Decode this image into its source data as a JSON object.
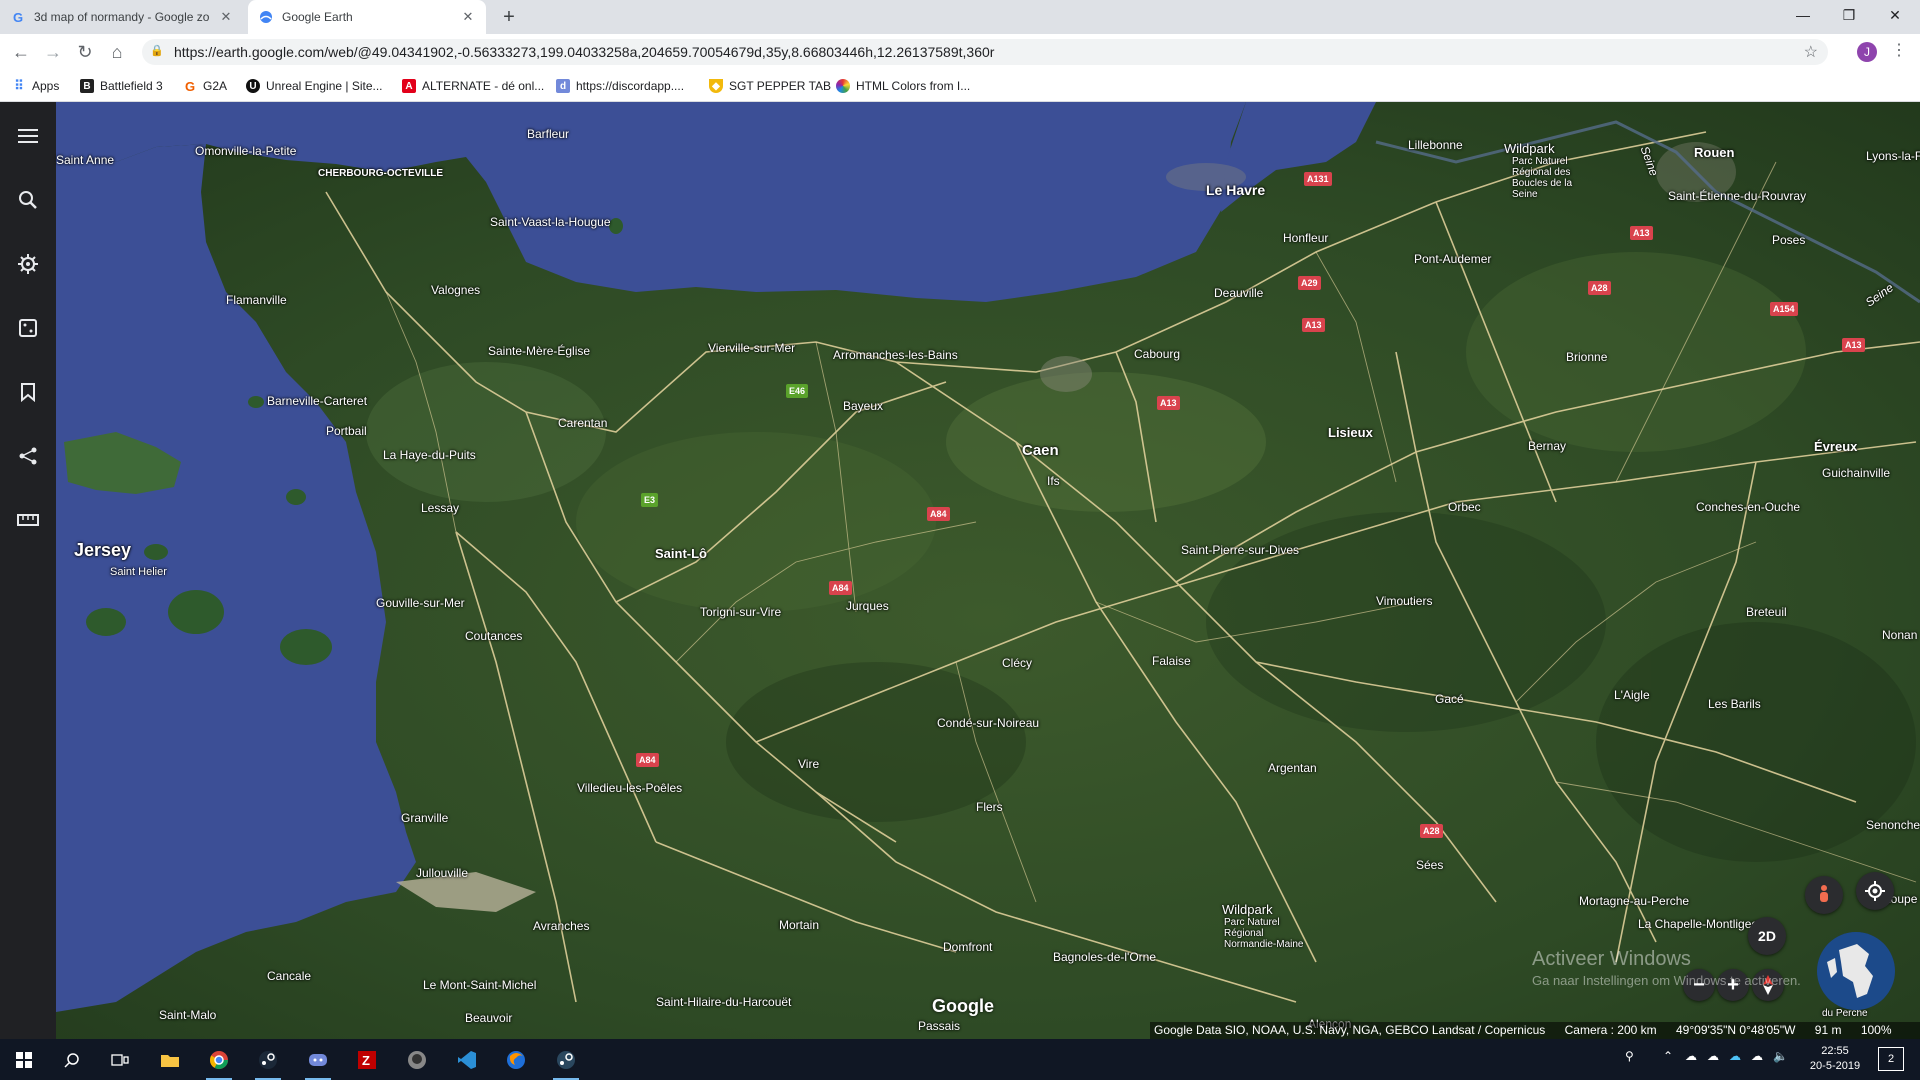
{
  "browser": {
    "tabs": [
      {
        "title": "3d map of normandy - Google zo",
        "active": false,
        "favicon": "google-icon"
      },
      {
        "title": "Google Earth",
        "active": true,
        "favicon": "earth-icon"
      }
    ],
    "url": "https://earth.google.com/web/@49.04341902,-0.56333273,199.04033258a,204659.70054679d,35y,8.66803446h,12.26137589t,360r",
    "profile_initial": "J",
    "bookmarks": [
      {
        "label": "Apps",
        "icon": "apps-grid-icon"
      },
      {
        "label": "Battlefield 3",
        "icon": "bf3-icon"
      },
      {
        "label": "G2A",
        "icon": "g2a-icon"
      },
      {
        "label": "Unreal Engine | Site...",
        "icon": "unreal-icon"
      },
      {
        "label": "ALTERNATE - dé onl...",
        "icon": "alternate-icon"
      },
      {
        "label": "https://discordapp....",
        "icon": "discord-icon"
      },
      {
        "label": "SGT PEPPER TAB",
        "icon": "shield-bookmark-icon"
      },
      {
        "label": "HTML Colors from I...",
        "icon": "color-wheel-icon"
      }
    ]
  },
  "earth": {
    "sidebar_icons": [
      "menu-icon",
      "search-icon",
      "voyager-icon",
      "feeling-lucky-icon",
      "projects-icon",
      "share-icon",
      "measure-icon"
    ],
    "places": {
      "saint_anne": "Saint Anne",
      "omonville": "Omonville-la-Petite",
      "cherbourg": "CHERBOURG-OCTEVILLE",
      "barfleur": "Barfleur",
      "saint_vaast": "Saint-Vaast-la-Hougue",
      "valognes": "Valognes",
      "flamanville": "Flamanville",
      "sainte_mere": "Sainte-Mère-Église",
      "barneville": "Barneville-Carteret",
      "portbail": "Portbail",
      "carentan": "Carentan",
      "la_haye": "La Haye-du-Puits",
      "lessay": "Lessay",
      "jersey": "Jersey",
      "saint_helier": "Saint Helier",
      "saint_lo": "Saint-Lô",
      "gouville": "Gouville-sur-Mer",
      "coutances": "Coutances",
      "torigni": "Torigni-sur-Vire",
      "jurques": "Jurques",
      "vierville": "Vierville-sur-Mer",
      "arromanches": "Arromanches-les-Bains",
      "bayeux": "Bayeux",
      "caen": "Caen",
      "ifs": "Ifs",
      "cabourg": "Cabourg",
      "le_havre": "Le Havre",
      "honfleur": "Honfleur",
      "deauville": "Deauville",
      "lillebonne": "Lillebonne",
      "wildpark1": "Wildpark",
      "pnr1": "Parc Naturel Régional des Boucles de la Seine",
      "rouen": "Rouen",
      "saint_etienne": "Saint-Étienne-du-Rouvray",
      "lyons": "Lyons-la-F",
      "poses": "Poses",
      "seine1": "Seine",
      "seine2": "Seine",
      "pont_audemer": "Pont-Audemer",
      "brionne": "Brionne",
      "lisieux": "Lisieux",
      "bernay": "Bernay",
      "evreux": "Évreux",
      "guichainville": "Guichainville",
      "orbec": "Orbec",
      "conches": "Conches-en-Ouche",
      "saint_pierre": "Saint-Pierre-sur-Dives",
      "vimoutiers": "Vimoutiers",
      "breteuil": "Breteuil",
      "nonan": "Nonan",
      "clecy": "Clécy",
      "falaise": "Falaise",
      "gace": "Gacé",
      "laigle": "L'Aigle",
      "les_barils": "Les Barils",
      "conde": "Condé-sur-Noireau",
      "vire": "Vire",
      "villedieu": "Villedieu-les-Poêles",
      "granville": "Granville",
      "flers": "Flers",
      "argentan": "Argentan",
      "sees": "Sées",
      "senonches": "Senonches",
      "jullouville": "Jullouville",
      "avranches": "Avranches",
      "mortain": "Mortain",
      "domfront": "Domfront",
      "bagnoles": "Bagnoles-de-l'Orne",
      "wildpark2": "Wildpark",
      "pnr2": "Parc Naturel Régional Normandie-Maine",
      "mortagne": "Mortagne-au-Perche",
      "la_chapelle": "La Chapelle-Montligeon",
      "loupe": "Loupe",
      "perche": "du Perche",
      "cancale": "Cancale",
      "saint_malo": "Saint-Malo",
      "mont_st_michel": "Le Mont-Saint-Michel",
      "saint_hilaire": "Saint-Hilaire-du-Harcouët",
      "beauvoir": "Beauvoir",
      "passais": "Passais",
      "alencon": "Alençon"
    },
    "shields": {
      "a131": "A131",
      "a13_1": "A13",
      "a28_1": "A28",
      "a154": "A154",
      "a13_2": "A13",
      "a29": "A29",
      "a13_3": "A13",
      "a13_4": "A13",
      "e46": "E46",
      "e3": "E3",
      "a84_1": "A84",
      "a84_2": "A84",
      "a84_3": "A84",
      "a28_2": "A28"
    },
    "controls": {
      "mode_2d": "2D",
      "zoom_out": "−",
      "zoom_in": "+"
    },
    "google_logo": "Google",
    "watermark_title": "Activeer Windows",
    "watermark_sub": "Ga naar Instellingen om Windows te activeren.",
    "attribution": "Google Data SIO, NOAA, U.S. Navy, NGA, GEBCO Landsat / Copernicus",
    "camera": "Camera : 200 km",
    "coordinates": "49°09'35\"N 0°48'05\"W",
    "elevation": "91 m",
    "zoom_pct": "100%"
  },
  "taskbar": {
    "time": "22:55",
    "date": "20-5-2019",
    "notification_count": "2",
    "apps": [
      "windows-start-icon",
      "search-icon",
      "task-view-icon",
      "file-explorer-icon",
      "chrome-icon",
      "steam-icon",
      "discord-icon",
      "filezilla-icon",
      "github-icon",
      "vscode-icon",
      "firefox-icon",
      "steam-icon"
    ]
  },
  "colors": {
    "sea": "#3c4f96",
    "land": "#2d4a27",
    "road": "#e8d6a0",
    "shield_red": "#d9434d",
    "shield_green": "#5aa22b",
    "sidebar": "#202124",
    "taskbar": "#101724"
  }
}
